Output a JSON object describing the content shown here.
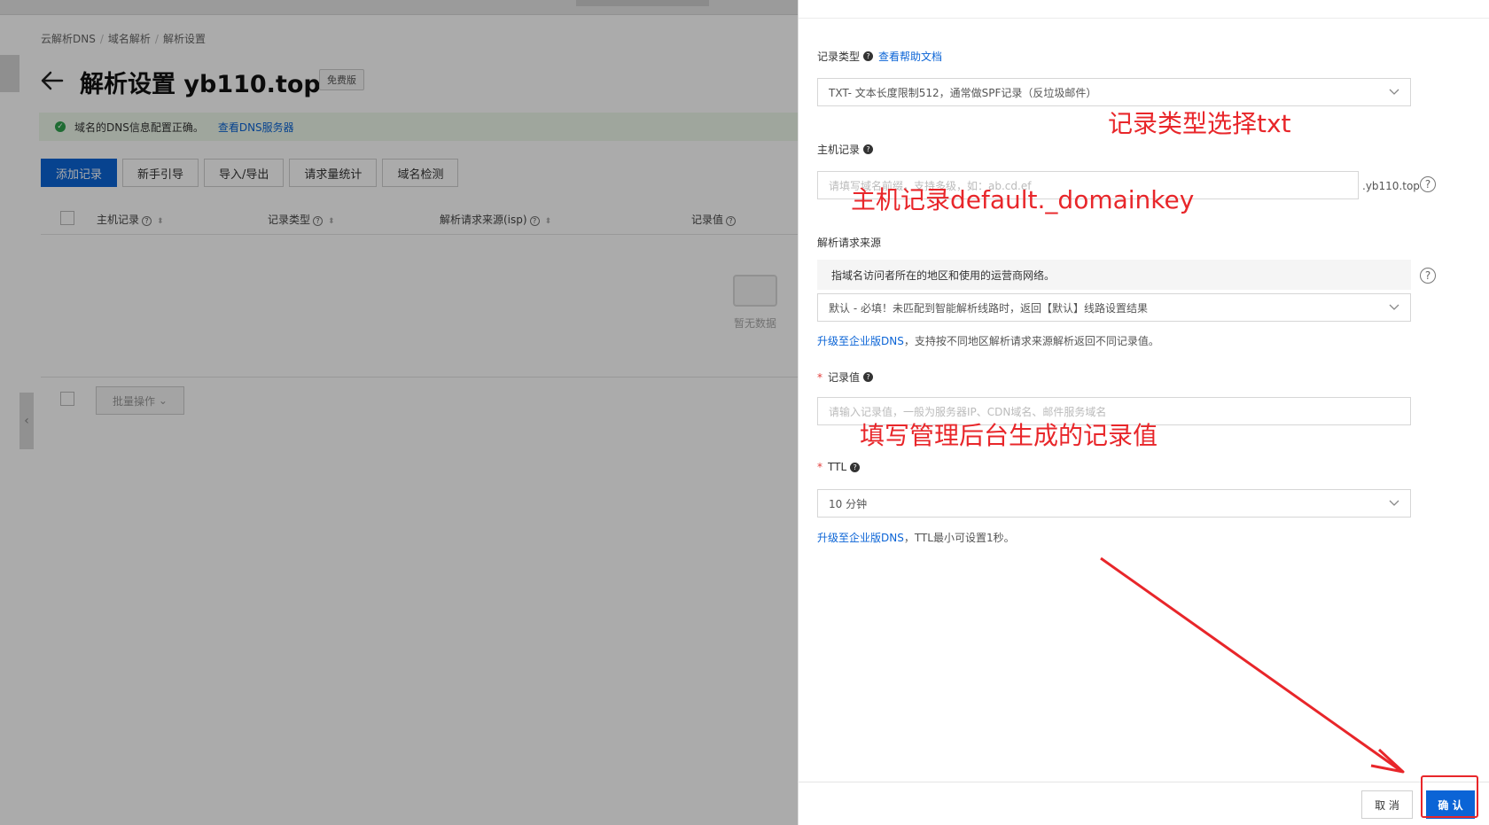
{
  "breadcrumb": {
    "item1": "云解析DNS",
    "item2": "域名解析",
    "item3": "解析设置",
    "separator": "/"
  },
  "page": {
    "title": "解析设置 yb110.top",
    "badge": "免费版"
  },
  "alert": {
    "message": "域名的DNS信息配置正确。",
    "link": "查看DNS服务器"
  },
  "toolbar": {
    "add_record": "添加记录",
    "guide": "新手引导",
    "import_export": "导入/导出",
    "request_stats": "请求量统计",
    "domain_check": "域名检测"
  },
  "table": {
    "col_host": "主机记录",
    "col_type": "记录类型",
    "col_source": "解析请求来源(isp)",
    "col_value": "记录值",
    "empty": "暂无数据",
    "batch": "批量操作"
  },
  "form": {
    "record_type": {
      "label": "记录类型",
      "help_link": "查看帮助文档",
      "value": "TXT- 文本长度限制512，通常做SPF记录（反垃圾邮件）"
    },
    "host": {
      "label": "主机记录",
      "placeholder": "请填写域名前缀，支持多级，如：ab.cd.ef",
      "suffix": ".yb110.top"
    },
    "source": {
      "label": "解析请求来源",
      "tip": "指域名访问者所在的地区和使用的运营商网络。",
      "value": "默认 - 必填！未匹配到智能解析线路时，返回【默认】线路设置结果",
      "hint_link": "升级至企业版DNS",
      "hint_text": "，支持按不同地区解析请求来源解析返回不同记录值。"
    },
    "value": {
      "label": "记录值",
      "required_mark": "*",
      "placeholder": "请输入记录值，一般为服务器IP、CDN域名、邮件服务域名"
    },
    "ttl": {
      "label": "TTL",
      "required_mark": "*",
      "value": "10 分钟",
      "hint_link": "升级至企业版DNS",
      "hint_text": "，TTL最小可设置1秒。"
    }
  },
  "annotations": {
    "type": "记录类型选择txt",
    "host": "主机记录default._domainkey",
    "value": "填写管理后台生成的记录值"
  },
  "footer": {
    "cancel": "取 消",
    "confirm": "确 认"
  },
  "colors": {
    "accent": "#0b64d6",
    "annotation": "#e8262a",
    "success": "#2fa14d"
  }
}
